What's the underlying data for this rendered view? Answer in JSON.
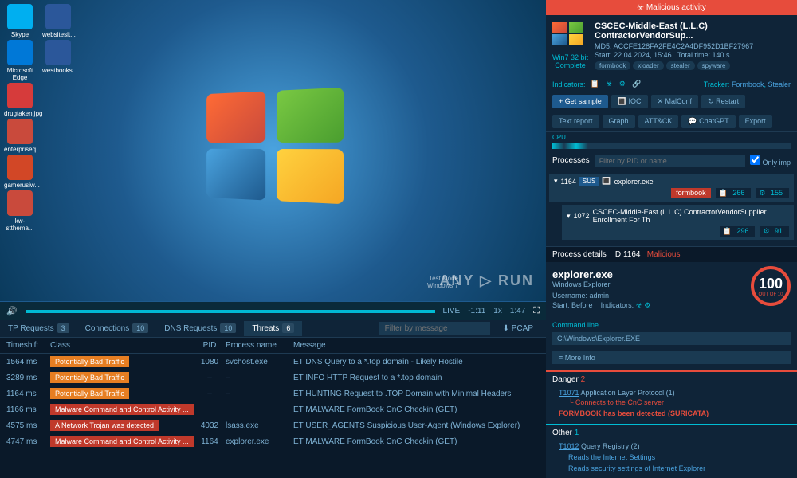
{
  "desktop": {
    "icons": [
      [
        "Skype",
        "websitesit..."
      ],
      [
        "Microsoft Edge",
        "westbooks..."
      ],
      [
        "drugtaken.jpg",
        ""
      ],
      [
        "enterpriseq...",
        ""
      ],
      [
        "gamerusiw...",
        ""
      ],
      [
        "kw-stthema...",
        ""
      ]
    ],
    "watermark": "ANY ▷ RUN",
    "vm_label1": "Test Mode",
    "vm_label2": "Windows 7"
  },
  "playback": {
    "live": "LIVE",
    "time": "-1:11",
    "speed": "1x",
    "end": "1:47"
  },
  "tabs": [
    {
      "label": "TP Requests",
      "count": "3"
    },
    {
      "label": "Connections",
      "count": "10"
    },
    {
      "label": "DNS Requests",
      "count": "10"
    },
    {
      "label": "Threats",
      "count": "6"
    }
  ],
  "filter_placeholder": "Filter by message",
  "pcap": "⬇ PCAP",
  "table": {
    "headers": [
      "Timeshift",
      "Class",
      "PID",
      "Process name",
      "Message"
    ],
    "rows": [
      {
        "time": "1564 ms",
        "class": "Potentially Bad Traffic",
        "cls": "orange",
        "pid": "1080",
        "proc": "svchost.exe",
        "msg": "ET DNS Query to a *.top domain - Likely Hostile"
      },
      {
        "time": "3289 ms",
        "class": "Potentially Bad Traffic",
        "cls": "orange",
        "pid": "–",
        "proc": "–",
        "msg": "ET INFO HTTP Request to a *.top domain"
      },
      {
        "time": "1164 ms",
        "class": "Potentially Bad Traffic",
        "cls": "orange",
        "pid": "–",
        "proc": "–",
        "msg": "ET HUNTING Request to .TOP Domain with Minimal Headers"
      },
      {
        "time": "1166 ms",
        "class": "Malware Command and Control Activity ...",
        "cls": "red",
        "pid": "",
        "proc": "",
        "msg": "ET MALWARE FormBook CnC Checkin (GET)"
      },
      {
        "time": "4575 ms",
        "class": "A Network Trojan was detected",
        "cls": "red",
        "pid": "4032",
        "proc": "lsass.exe",
        "msg": "ET USER_AGENTS Suspicious User-Agent (Windows Explorer)"
      },
      {
        "time": "4747 ms",
        "class": "Malware Command and Control Activity ...",
        "cls": "red",
        "pid": "1164",
        "proc": "explorer.exe",
        "msg": "ET MALWARE FormBook CnC Checkin (GET)"
      }
    ]
  },
  "right": {
    "banner": "☣ Malicious activity",
    "file_title": "CSCEC-Middle-East (L.L.C) ContractorVendorSup...",
    "md5_label": "MD5:",
    "md5": "ACCFE128FA2FE4C2A4DF952D1BF27967",
    "start_label": "Start:",
    "start": "22.04.2024, 15:46",
    "total_label": "Total time:",
    "total": "140 s",
    "os": "Win7 32 bit",
    "os_status": "Complete",
    "tags": [
      "formbook",
      "xloader",
      "stealer",
      "spyware"
    ],
    "indicators_label": "Indicators:",
    "tracker_label": "Tracker:",
    "tracker_links": [
      "Formbook",
      "Stealer"
    ],
    "actions1": [
      "+ Get sample",
      "🔳 IOC",
      "✕ MalConf",
      "↻ Restart"
    ],
    "actions2": [
      "Text report",
      "Graph",
      "ATT&CK",
      "💬 ChatGPT",
      "Export"
    ],
    "cpu_label": "CPU",
    "proc_label": "Processes",
    "proc_filter": "Filter by PID or name",
    "only_imp": "Only imp",
    "processes": [
      {
        "pid": "1164",
        "badge": "SUS",
        "name": "explorer.exe",
        "fb": "formbook",
        "n1": "266",
        "n2": "155"
      },
      {
        "pid": "1072",
        "name": "CSCEC-Middle-East (L.L.C) ContractorVendorSupplier Enrollment For Th",
        "n1": "296",
        "n2": "91"
      }
    ],
    "details": {
      "header": "Process details",
      "id_label": "ID",
      "id": "1164",
      "status": "Malicious",
      "name": "explorer.exe",
      "desc": "Windows Explorer",
      "user_label": "Username:",
      "user": "admin",
      "start_label": "Start:",
      "start": "Before",
      "ind_label": "Indicators:",
      "score": "100",
      "score_sub": "OUT OF 10",
      "cmd_label": "Command line",
      "cmd": "C:\\Windows\\Explorer.EXE",
      "more": "≡ More Info"
    },
    "danger": {
      "label": "Danger",
      "count": "2",
      "items": [
        {
          "code": "T1071",
          "text": "Application Layer Protocol (1)"
        }
      ],
      "sub": "Connects to the CnC server",
      "detected": "FORMBOOK has been detected (SURICATA)"
    },
    "other": {
      "label": "Other",
      "count": "1",
      "items": [
        {
          "code": "T1012",
          "text": "Query Registry (2)"
        }
      ],
      "subs": [
        "Reads the Internet Settings",
        "Reads security settings of Internet Explorer"
      ]
    }
  }
}
